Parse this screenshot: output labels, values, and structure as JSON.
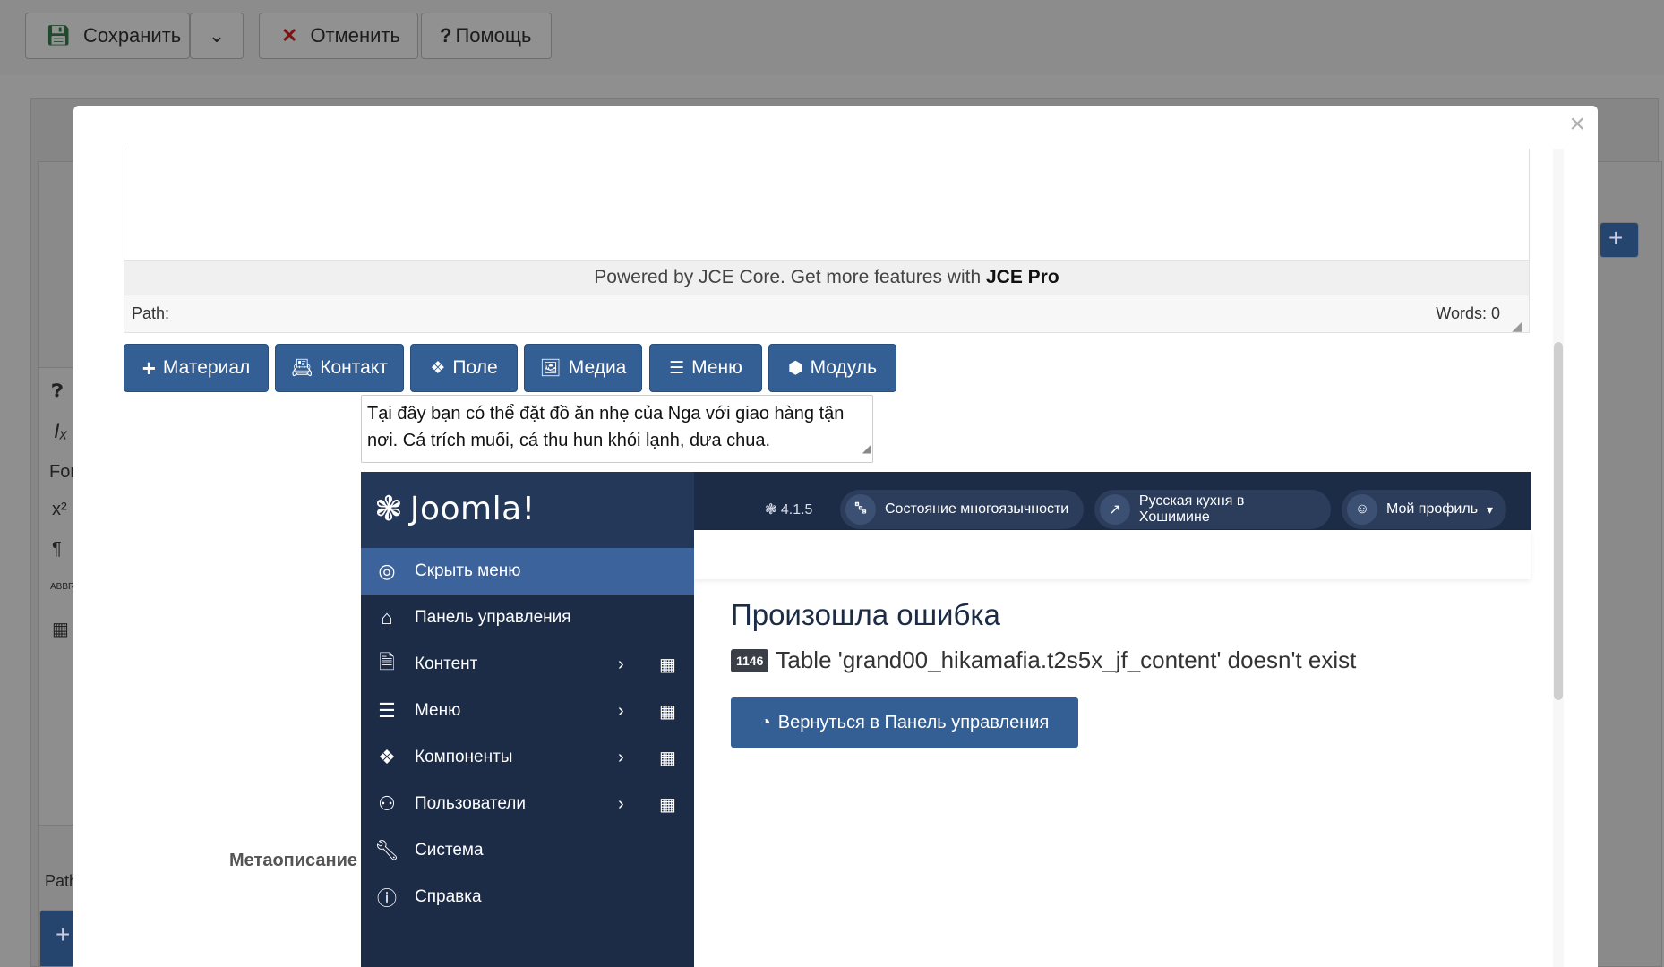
{
  "background": {
    "toolbar": {
      "save_label": "Сохранить",
      "cancel_label": "Отменить",
      "help_label": "Помощь"
    },
    "side_text": {
      "format_label": "For",
      "path_label": "Path",
      "abbr_label": "ABBR"
    }
  },
  "modal": {
    "close_label": "×",
    "editor": {
      "powered_prefix": "Powered by JCE Core. Get more features with ",
      "powered_brand": "JCE Pro",
      "path_label": "Path:",
      "words_label": "Words: 0"
    },
    "insert_buttons": [
      {
        "label": "Материал",
        "icon": "plus-icon"
      },
      {
        "label": "Контакт",
        "icon": "contact-card-icon"
      },
      {
        "label": "Поле",
        "icon": "puzzle-icon"
      },
      {
        "label": "Медиа",
        "icon": "image-icon"
      },
      {
        "label": "Меню",
        "icon": "list-icon"
      },
      {
        "label": "Модуль",
        "icon": "cube-icon"
      }
    ],
    "meta_description": {
      "label": "Метаописание",
      "value": "Tại đây bạn có thể đặt đồ ăn nhẹ của Nga với giao hàng tận nơi. Cá trích muối, cá thu hun khói lạnh, dưa chua."
    }
  },
  "joomla": {
    "logo_text": "Joomla!",
    "version": "4.1.5",
    "header_pills": [
      {
        "label": "Состояние многоязычности",
        "icon": "language-icon"
      },
      {
        "label": "Русская кухня в Хошимине",
        "icon": "external-link-icon"
      },
      {
        "label": "Мой профиль",
        "icon": "user-circle-icon"
      }
    ],
    "sidebar": [
      {
        "label": "Скрыть меню",
        "icon": "toggle-icon",
        "active": true
      },
      {
        "label": "Панель управления",
        "icon": "home-icon"
      },
      {
        "label": "Контент",
        "icon": "file-icon",
        "expandable": true
      },
      {
        "label": "Меню",
        "icon": "list-icon",
        "expandable": true
      },
      {
        "label": "Компоненты",
        "icon": "puzzle-icon",
        "expandable": true
      },
      {
        "label": "Пользователи",
        "icon": "users-icon",
        "expandable": true
      },
      {
        "label": "Система",
        "icon": "wrench-icon"
      },
      {
        "label": "Справка",
        "icon": "info-icon"
      }
    ],
    "error": {
      "title": "Произошла ошибка",
      "code": "1146",
      "message": "Table 'grand00_hikamafia.t2s5x_jf_content' doesn't exist",
      "back_button": "Вернуться в Панель управления"
    }
  }
}
